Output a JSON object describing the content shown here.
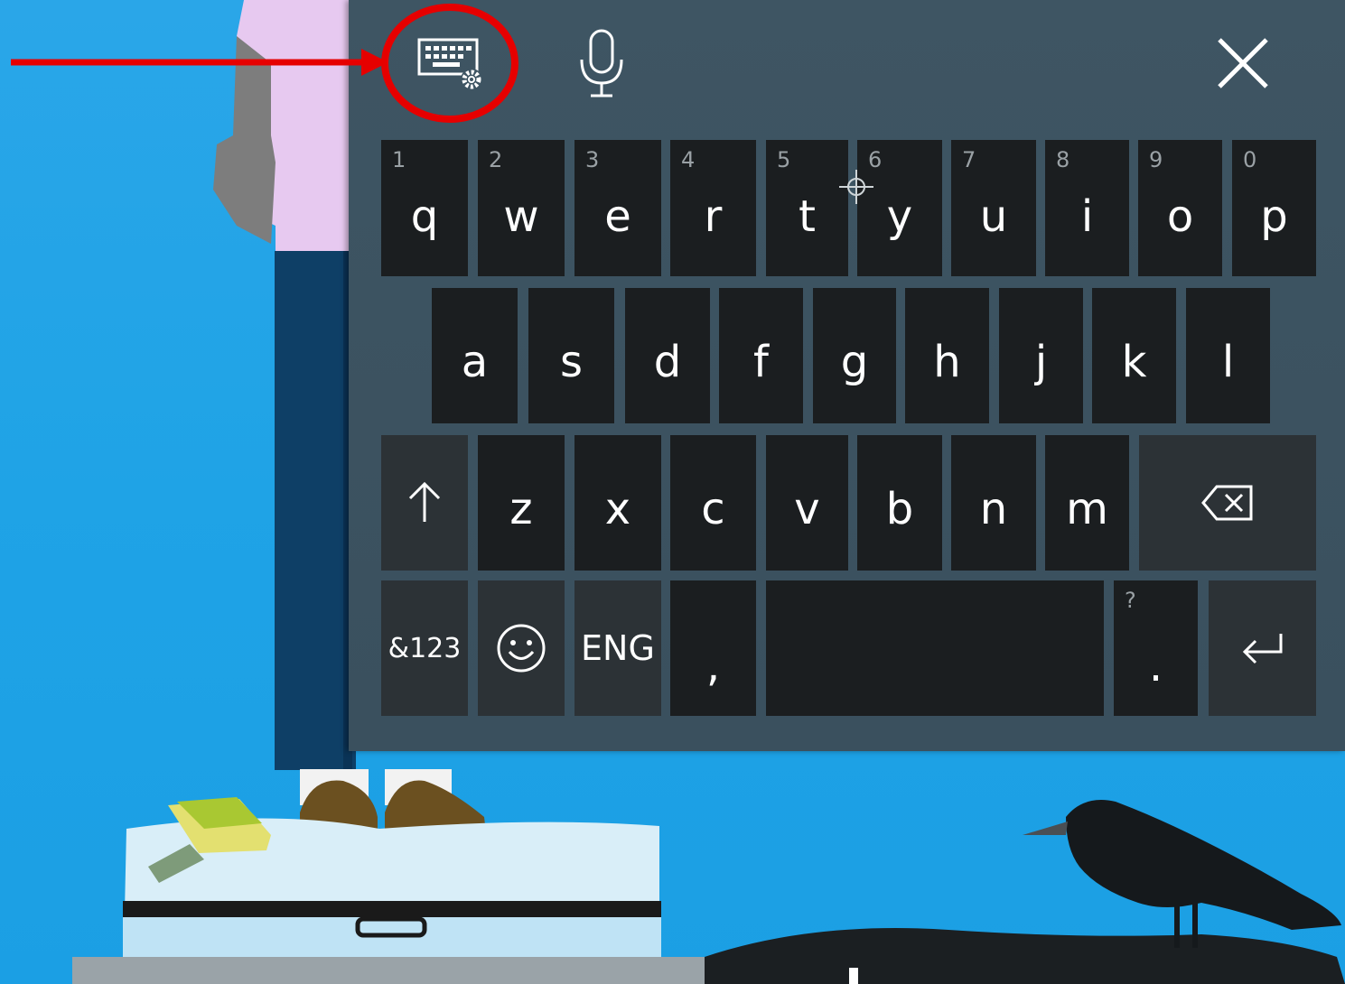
{
  "keyboard": {
    "toolbar": {
      "settings_icon": "keyboard-settings-icon",
      "mic_icon": "microphone-icon",
      "close_icon": "close-icon"
    },
    "rows": [
      [
        {
          "label": "q",
          "secondary": "1"
        },
        {
          "label": "w",
          "secondary": "2"
        },
        {
          "label": "e",
          "secondary": "3"
        },
        {
          "label": "r",
          "secondary": "4"
        },
        {
          "label": "t",
          "secondary": "5"
        },
        {
          "label": "y",
          "secondary": "6"
        },
        {
          "label": "u",
          "secondary": "7"
        },
        {
          "label": "i",
          "secondary": "8"
        },
        {
          "label": "o",
          "secondary": "9"
        },
        {
          "label": "p",
          "secondary": "0"
        }
      ],
      [
        {
          "label": "a"
        },
        {
          "label": "s"
        },
        {
          "label": "d"
        },
        {
          "label": "f"
        },
        {
          "label": "g"
        },
        {
          "label": "h"
        },
        {
          "label": "j"
        },
        {
          "label": "k"
        },
        {
          "label": "l"
        }
      ],
      [
        {
          "label": "z"
        },
        {
          "label": "x"
        },
        {
          "label": "c"
        },
        {
          "label": "v"
        },
        {
          "label": "b"
        },
        {
          "label": "n"
        },
        {
          "label": "m"
        }
      ]
    ],
    "shift_icon": "shift-arrow-icon",
    "backspace_icon": "backspace-icon",
    "symbols_label": "&123",
    "emoji_icon": "smiley-icon",
    "language_label": "ENG",
    "comma_label": ",",
    "period_label": ".",
    "period_secondary": "?",
    "enter_icon": "enter-icon"
  },
  "annotation": {
    "arrow_color": "#e60000",
    "circle_color": "#e60000"
  }
}
